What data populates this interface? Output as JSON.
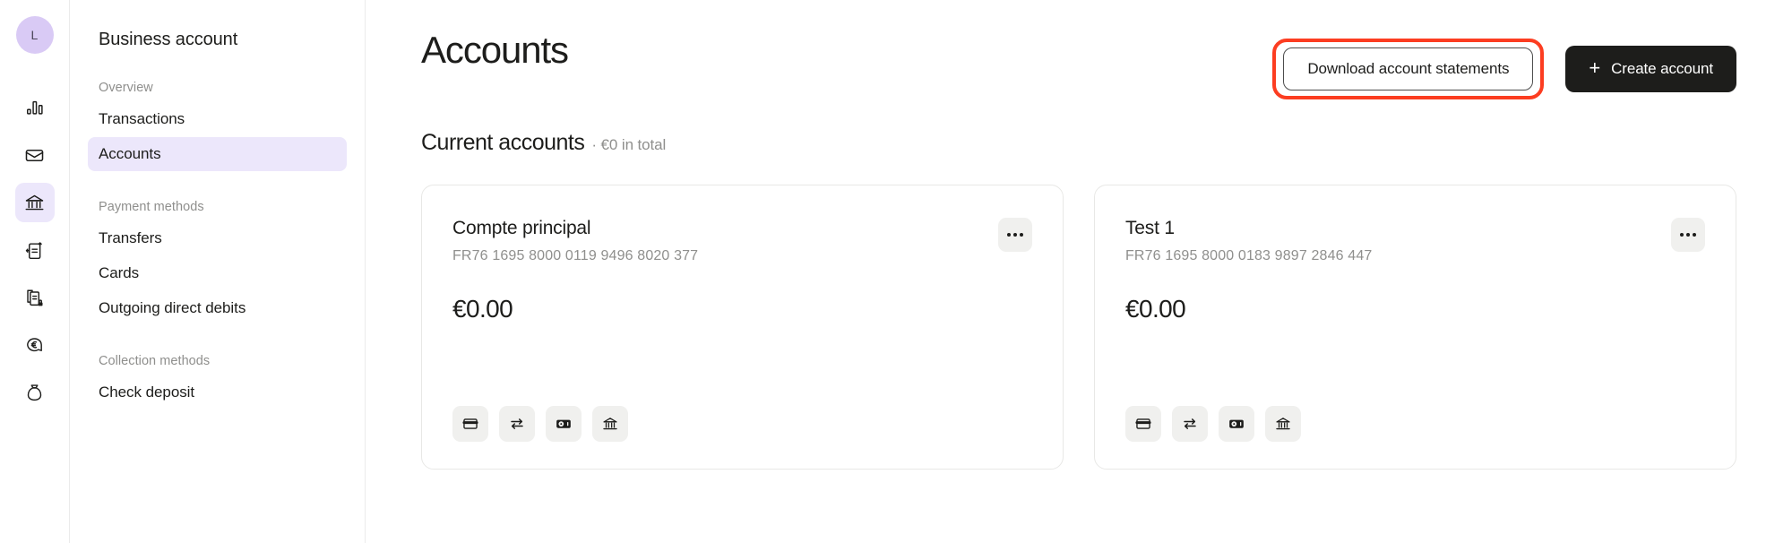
{
  "rail": {
    "avatar_initial": "L",
    "icons": [
      {
        "name": "bar-chart-icon",
        "active": false
      },
      {
        "name": "inbox-icon",
        "active": false
      },
      {
        "name": "bank-icon",
        "active": true
      },
      {
        "name": "invoice-outgoing-icon",
        "active": false
      },
      {
        "name": "documents-lock-icon",
        "active": false
      },
      {
        "name": "euro-speech-icon",
        "active": false
      },
      {
        "name": "money-bag-icon",
        "active": false
      }
    ]
  },
  "sidebar": {
    "workspace_title": "Business account",
    "groups": [
      {
        "label": "Overview",
        "items": [
          {
            "label": "Transactions",
            "selected": false
          },
          {
            "label": "Accounts",
            "selected": true
          }
        ]
      },
      {
        "label": "Payment methods",
        "items": [
          {
            "label": "Transfers",
            "selected": false
          },
          {
            "label": "Cards",
            "selected": false
          },
          {
            "label": "Outgoing direct debits",
            "selected": false
          }
        ]
      },
      {
        "label": "Collection methods",
        "items": [
          {
            "label": "Check deposit",
            "selected": false
          }
        ]
      }
    ]
  },
  "header": {
    "title": "Accounts",
    "download_button": "Download account statements",
    "create_button": "Create account",
    "create_button_plus": "+",
    "highlight_color": "#fc3d21",
    "primary_color": "#1d1d1b"
  },
  "section": {
    "title": "Current accounts",
    "subtitle": "· €0 in total"
  },
  "accounts": [
    {
      "name": "Compte principal",
      "iban": "FR76 1695 8000 0119 9496 8020 377",
      "balance": "€0.00",
      "actions": [
        "card-icon",
        "transfer-arrows-icon",
        "cash-banknote-icon",
        "bank-icon"
      ]
    },
    {
      "name": "Test 1",
      "iban": "FR76 1695 8000 0183 9897 2846 447",
      "balance": "€0.00",
      "actions": [
        "card-icon",
        "transfer-arrows-icon",
        "cash-banknote-icon",
        "bank-icon"
      ]
    }
  ],
  "colors": {
    "accent_selected": "#ece7fb",
    "avatar_bg": "#d9caf5",
    "muted_text": "#8f8f8d",
    "card_border": "#e8e8e6",
    "icon_chip_bg": "#f0f0ee"
  }
}
